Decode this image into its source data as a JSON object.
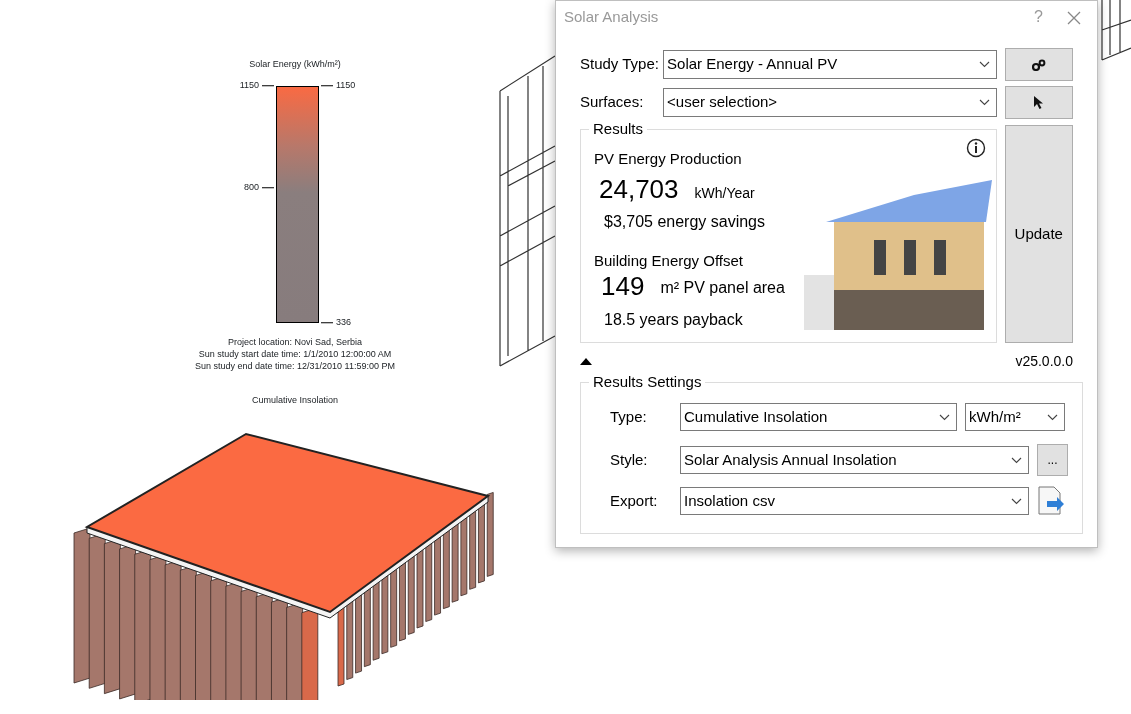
{
  "canvas": {
    "legend": {
      "title": "Solar Energy (kWh/m²)",
      "ticks": [
        {
          "label": "1150",
          "kind": "left"
        },
        {
          "label": "1150",
          "kind": "right"
        },
        {
          "label": "800",
          "kind": "left"
        },
        {
          "label": "336",
          "kind": "right"
        }
      ],
      "notes": [
        "Project location: Novi Sad, Serbia",
        "Sun study start date time: 1/1/2010 12:00:00 AM",
        "Sun study end date time: 12/31/2010 11:59:00 PM"
      ]
    },
    "view_title": "Cumulative Insolation"
  },
  "dialog": {
    "title": "Solar Analysis",
    "help": "?",
    "study_type": {
      "label": "Study Type:",
      "value": "Solar Energy - Annual PV"
    },
    "surfaces": {
      "label": "Surfaces:",
      "value": "<user selection>"
    },
    "results": {
      "title": "Results",
      "pv_heading": "PV Energy Production",
      "pv_value": "24,703",
      "pv_unit": "kWh/Year",
      "savings": "$3,705 energy savings",
      "offset_heading": "Building Energy Offset",
      "offset_value": "149",
      "offset_unit": "m² PV panel area",
      "payback": "18.5 years payback"
    },
    "update_button": "Update",
    "version": "v25.0.0.0",
    "settings": {
      "title": "Results Settings",
      "type": {
        "label": "Type:",
        "value": "Cumulative Insolation",
        "unit": "kWh/m²"
      },
      "style": {
        "label": "Style:",
        "value": "Solar Analysis Annual Insolation",
        "button": "..."
      },
      "export": {
        "label": "Export:",
        "value": "Insolation csv"
      }
    }
  }
}
